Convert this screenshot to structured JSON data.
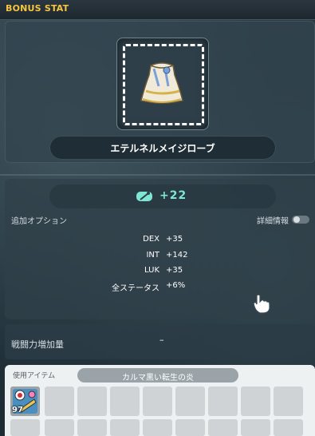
{
  "window": {
    "title": "BONUS STAT"
  },
  "item": {
    "name": "エテルネルメイジローブ",
    "icon": "robe-item-icon"
  },
  "bonus": {
    "value": "+22",
    "icon": "bonus-stat-icon"
  },
  "options": {
    "label": "追加オプション",
    "detail_label": "詳細情報",
    "stats": [
      {
        "name": "DEX",
        "value": "+35"
      },
      {
        "name": "INT",
        "value": "+142"
      },
      {
        "name": "LUK",
        "value": "+35"
      },
      {
        "name": "全ステータス",
        "value": "+6%"
      }
    ]
  },
  "power": {
    "label": "戦闘力増加量",
    "value": "–"
  },
  "inventory": {
    "label": "使用アイテム",
    "title": "カルマ黒い転生の炎",
    "items": [
      {
        "count": "97"
      }
    ]
  },
  "colors": {
    "title": "#f6c640",
    "plus": "#7ee6d3"
  }
}
